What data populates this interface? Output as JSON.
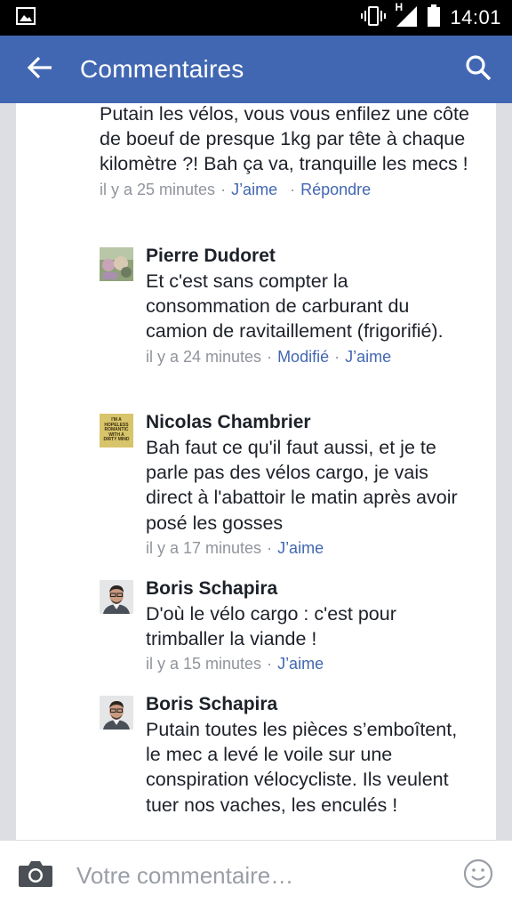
{
  "status_bar": {
    "time": "14:01",
    "network_label": "H",
    "icons": [
      "image-icon",
      "vibrate-icon",
      "signal-icon",
      "battery-icon"
    ]
  },
  "app_bar": {
    "title": "Commentaires",
    "back_icon": "arrow-left-icon",
    "search_icon": "search-icon",
    "color": "#4267b2"
  },
  "first_comment": {
    "text": "Putain les vélos, vous vous enfilez une côte de boeuf de presque 1kg par tête à chaque kilomètre ?! Bah ça va, tranquille les mecs !",
    "time": "il y a 25 minutes",
    "actions": [
      "J’aime",
      "Répondre"
    ]
  },
  "replies": [
    {
      "author": "Pierre Dudoret",
      "text": "Et c'est sans compter la consommation de carburant du camion de ravitaillement (frigorifié).",
      "time": "il y a 24 minutes",
      "actions": [
        "Modifié",
        "J’aime"
      ]
    },
    {
      "author": "Nicolas Chambrier",
      "avatar_text": "I'M A HOPELESS ROMANTIC WITH A DIRTY MIND",
      "text": "Bah faut ce qu'il faut aussi, et je te parle pas des vélos cargo, je vais direct à l'abattoir le matin après avoir posé les gosses",
      "time": "il y a 17 minutes",
      "actions": [
        "J’aime"
      ]
    },
    {
      "author": "Boris Schapira",
      "text": "D'où le vélo cargo : c'est pour trimballer la viande !",
      "time": "il y a 15 minutes",
      "actions": [
        "J’aime"
      ]
    },
    {
      "author": "Boris Schapira",
      "text": "Putain toutes les pièces s’emboîtent, le mec a levé le voile sur une conspiration vélocycliste. Ils veulent tuer nos vaches, les enculés !",
      "time": "",
      "actions": []
    }
  ],
  "composer": {
    "placeholder": "Votre commentaire…",
    "camera_icon": "camera-icon",
    "emoji_icon": "smiley-icon"
  }
}
